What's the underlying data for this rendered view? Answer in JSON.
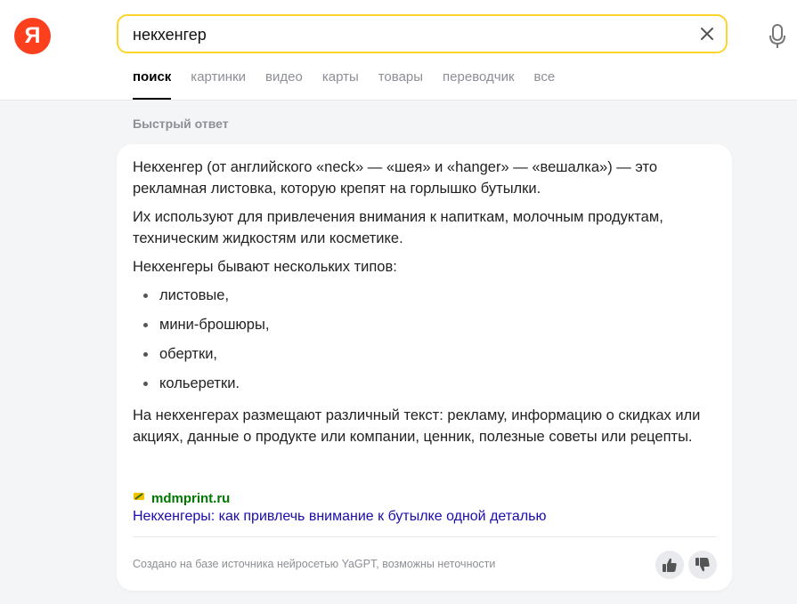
{
  "header": {
    "logo_text": "Я",
    "search": {
      "value": "некхенгер",
      "placeholder": ""
    },
    "clear_icon": "close-icon",
    "mic_icon": "microphone-icon",
    "tabs": [
      {
        "label": "поиск",
        "active": true
      },
      {
        "label": "картинки"
      },
      {
        "label": "видео"
      },
      {
        "label": "карты"
      },
      {
        "label": "товары"
      },
      {
        "label": "переводчик"
      },
      {
        "label": "все"
      }
    ]
  },
  "quick_answer": {
    "section_title": "Быстрый ответ",
    "paragraphs": [
      "Некхенгер (от английского «neck» — «шея» и «hanger» — «вешалка») — это рекламная листовка, которую крепят на горлышко бутылки.",
      "Их используют для привлечения внимания к напиткам, молочным продуктам, техническим жидкостям или косметике.",
      "Некхенгеры бывают нескольких типов:"
    ],
    "list_items": [
      "листовые,",
      "мини-брошюры,",
      "обертки,",
      "кольеретки."
    ],
    "closing_paragraph": "На некхенгерах размещают различный текст: рекламу, информацию о скидках или акциях, данные о продукте или компании, ценник, полезные советы или рецепты.",
    "source": {
      "site": "mdmprint.ru",
      "title": "Некхенгеры: как привлечь внимание к бутылке одной деталью"
    },
    "disclaimer": "Создано на базе источника нейросетью YaGPT, возможны неточности",
    "feedback": {
      "like_icon": "thumbs-up-icon",
      "dislike_icon": "thumbs-down-icon"
    }
  },
  "colors": {
    "brand": "#fc3f1d",
    "search_border": "#fed42b",
    "link": "#1a0dab",
    "source_green": "#007700",
    "muted": "#8c8f96"
  }
}
